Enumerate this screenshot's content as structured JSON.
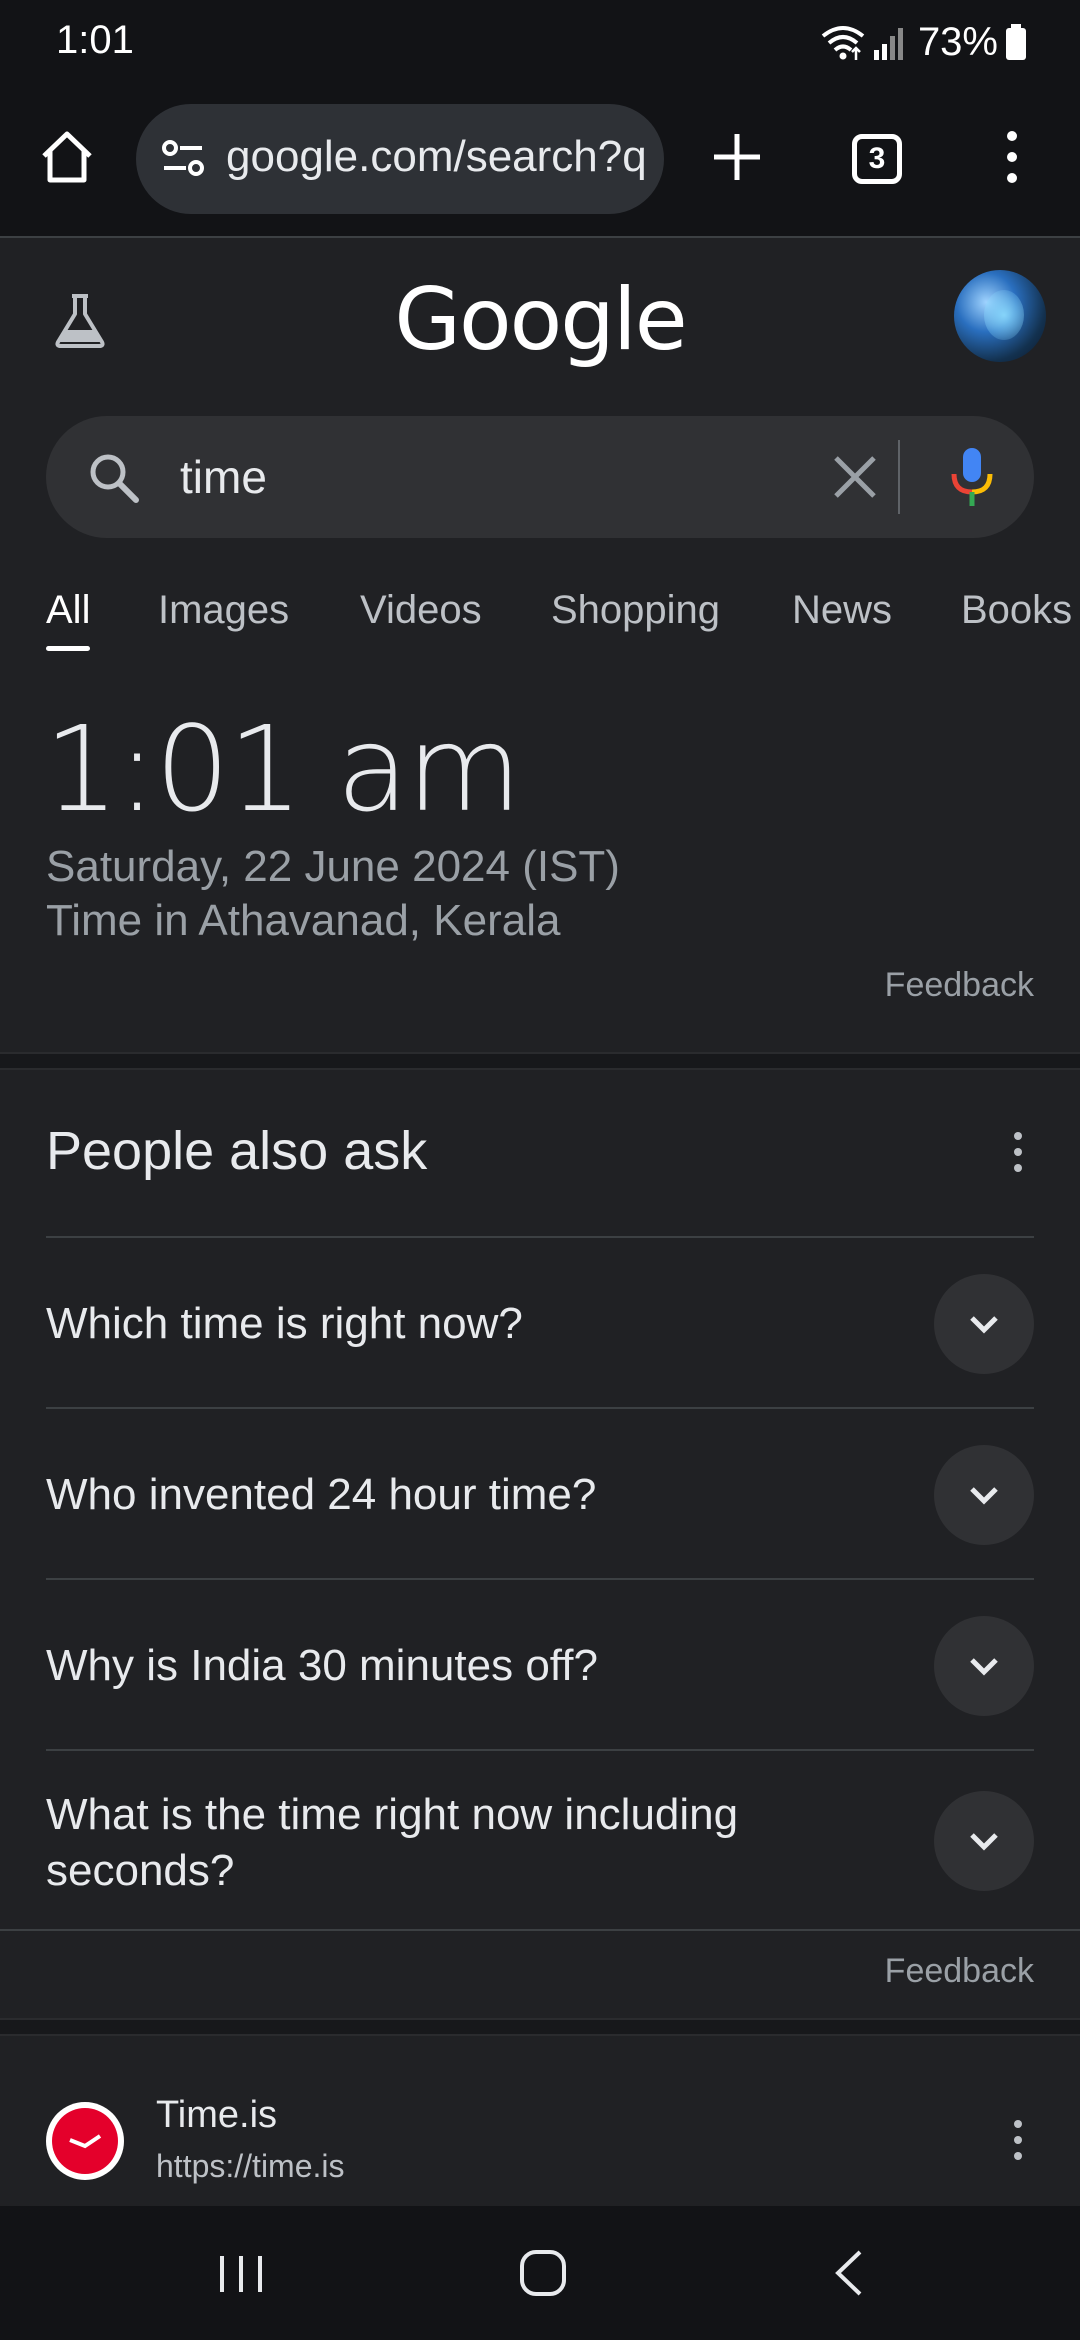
{
  "status_bar": {
    "time": "1:01",
    "battery": "73%"
  },
  "browser": {
    "url": "google.com/search?q=time",
    "tab_count": "3"
  },
  "google": {
    "logo": "Google"
  },
  "search": {
    "query": "time"
  },
  "tabs": [
    "All",
    "Images",
    "Videos",
    "Shopping",
    "News",
    "Books"
  ],
  "time_card": {
    "time": "1:01 am",
    "date": "Saturday, 22 June 2024 (IST)",
    "location": "Time in Athavanad, Kerala",
    "feedback": "Feedback"
  },
  "people_also_ask": {
    "title": "People also ask",
    "questions": [
      "Which time is right now?",
      "Who invented 24 hour time?",
      "Why is India 30 minutes off?",
      "What is the time right now including seconds?"
    ],
    "feedback": "Feedback"
  },
  "result": {
    "title": "Time.is",
    "url": "https://time.is"
  },
  "colors": {
    "background": "#202124",
    "toolbar": "#121316",
    "favicon_red": "#e4002b"
  },
  "icons": [
    "home-icon",
    "tune-icon",
    "plus-icon",
    "tabs-icon",
    "more-vert-icon",
    "labs-icon",
    "search-icon",
    "clear-icon",
    "mic-icon",
    "chevron-down-icon",
    "recents-icon",
    "nav-home-icon",
    "back-icon"
  ]
}
